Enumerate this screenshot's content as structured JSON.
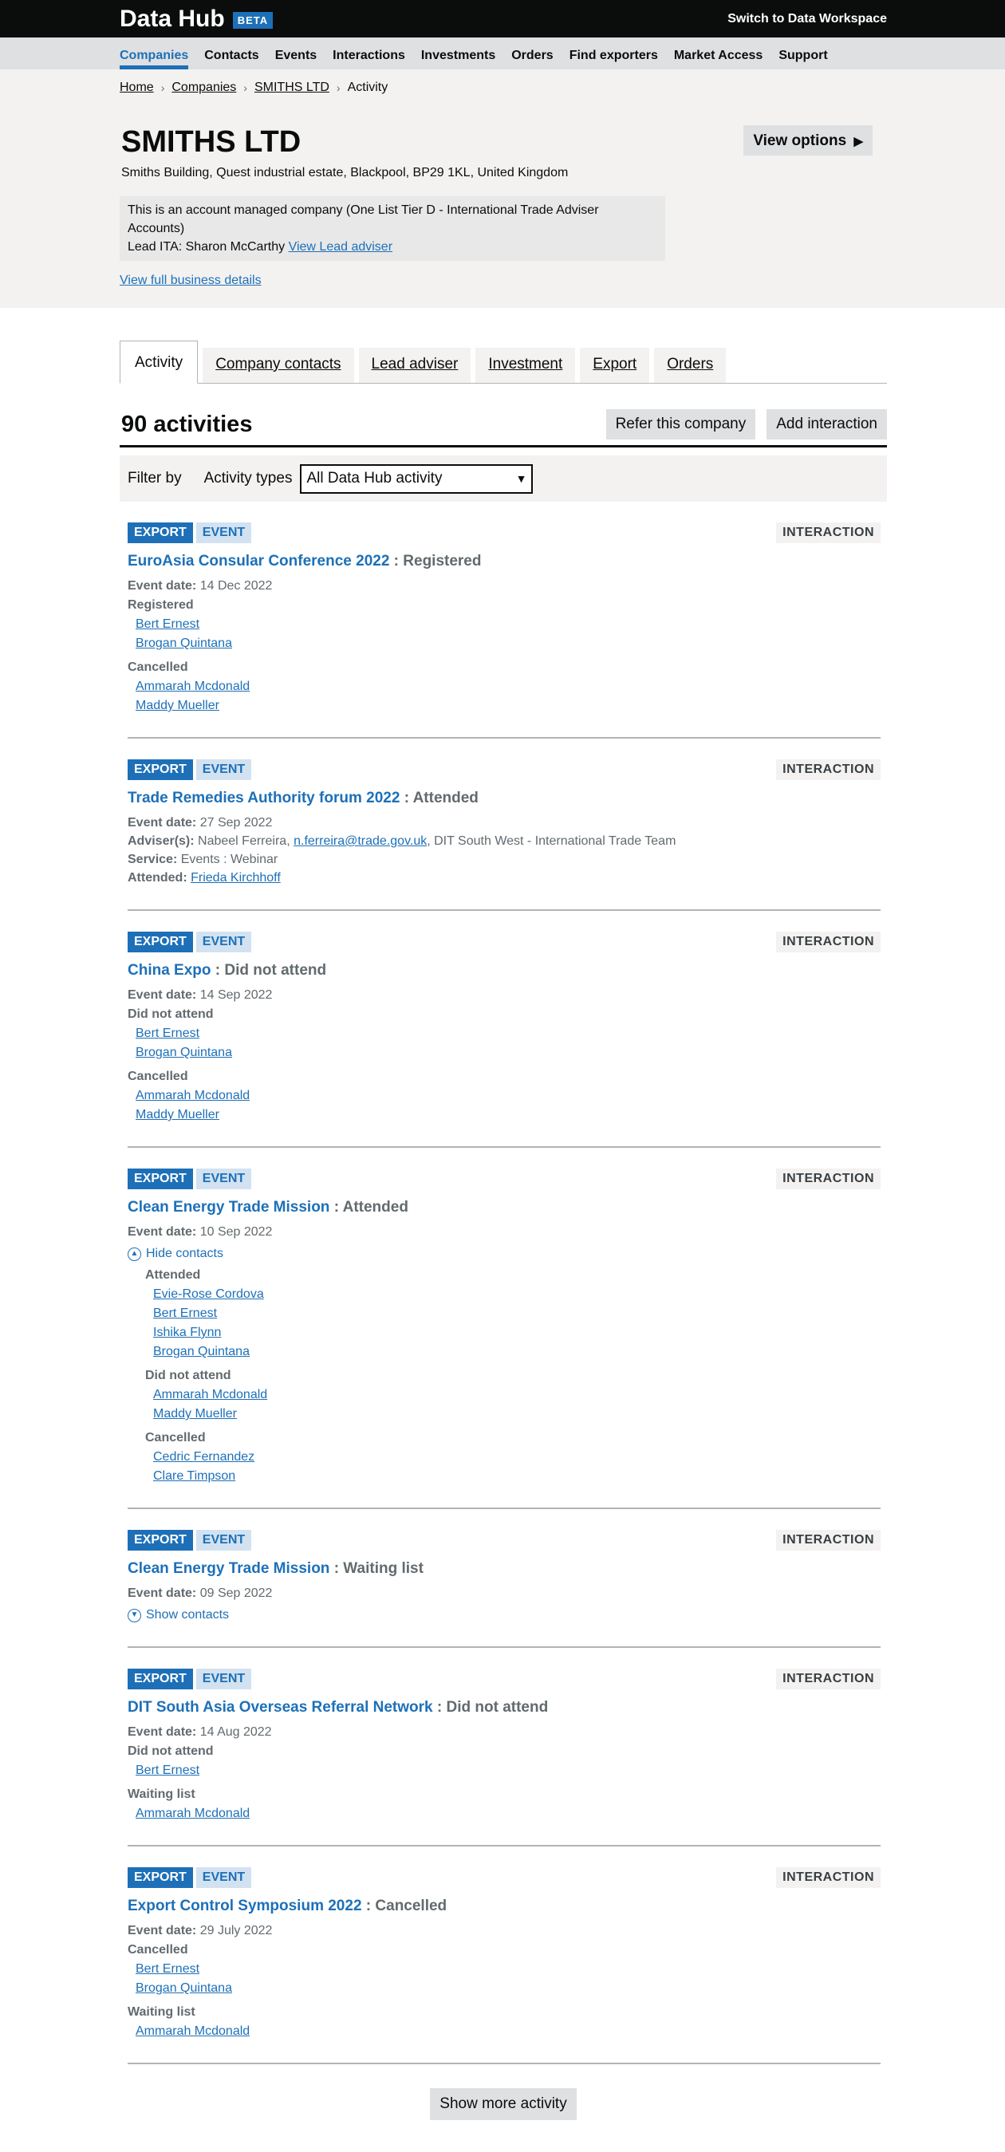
{
  "header": {
    "logo": "Data Hub",
    "beta": "BETA",
    "switch_link": "Switch to Data Workspace"
  },
  "nav": {
    "items": [
      "Companies",
      "Contacts",
      "Events",
      "Interactions",
      "Investments",
      "Orders",
      "Find exporters",
      "Market Access",
      "Support"
    ],
    "active": "Companies"
  },
  "breadcrumbs": {
    "home": "Home",
    "companies": "Companies",
    "company": "SMITHS LTD",
    "current": "Activity"
  },
  "company": {
    "name": "SMITHS LTD",
    "address": "Smiths Building, Quest industrial estate, Blackpool, BP29 1KL, United Kingdom",
    "view_options": "View options",
    "managed_text": "This is an account managed company (One List Tier D - International Trade Adviser Accounts)",
    "lead_ita_text": "Lead ITA: Sharon McCarthy",
    "view_lead_adviser": "View Lead adviser",
    "full_details": "View full business details"
  },
  "tabs": [
    "Activity",
    "Company contacts",
    "Lead adviser",
    "Investment",
    "Export",
    "Orders"
  ],
  "activity_header": {
    "count": "90 activities",
    "refer": "Refer this company",
    "add": "Add interaction"
  },
  "filter": {
    "filter_by": "Filter by",
    "activity_types": "Activity types",
    "selected": "All Data Hub activity"
  },
  "badges": {
    "export": "EXPORT",
    "event": "EVENT",
    "interaction": "INTERACTION"
  },
  "activities": [
    {
      "title": "EuroAsia Consular Conference 2022",
      "status": ": Registered",
      "event_date_label": "Event date:",
      "event_date": "14 Dec 2022",
      "groups": [
        {
          "label": "Registered",
          "contacts": [
            "Bert Ernest",
            "Brogan Quintana"
          ]
        },
        {
          "label": "Cancelled",
          "contacts": [
            "Ammarah Mcdonald",
            "Maddy Mueller"
          ]
        }
      ]
    },
    {
      "title": "Trade Remedies Authority forum 2022",
      "status": ": Attended",
      "event_date_label": "Event date:",
      "event_date": "27 Sep 2022",
      "advisers_label": "Adviser(s):",
      "advisers_name": "Nabeel Ferreira,",
      "advisers_email": "n.ferreira@trade.gov.uk",
      "advisers_team": ", DIT South West - International Trade Team",
      "service_label": "Service:",
      "service": "Events : Webinar",
      "attended_label": "Attended:",
      "attended": "Frieda Kirchhoff"
    },
    {
      "title": "China Expo",
      "status": ": Did not attend",
      "event_date_label": "Event date:",
      "event_date": "14 Sep 2022",
      "groups": [
        {
          "label": "Did not attend",
          "contacts": [
            "Bert Ernest",
            "Brogan Quintana"
          ]
        },
        {
          "label": "Cancelled",
          "contacts": [
            "Ammarah Mcdonald",
            "Maddy Mueller"
          ]
        }
      ]
    },
    {
      "title": "Clean Energy Trade Mission",
      "status": ": Attended",
      "event_date_label": "Event date:",
      "event_date": "10 Sep 2022",
      "toggle": "Hide contacts",
      "groups": [
        {
          "label": "Attended",
          "contacts": [
            "Evie-Rose Cordova",
            "Bert Ernest",
            "Ishika Flynn",
            "Brogan Quintana"
          ]
        },
        {
          "label": "Did not attend",
          "contacts": [
            "Ammarah Mcdonald",
            "Maddy Mueller"
          ]
        },
        {
          "label": "Cancelled",
          "contacts": [
            "Cedric Fernandez",
            "Clare Timpson"
          ]
        }
      ]
    },
    {
      "title": "Clean Energy Trade Mission",
      "status": ": Waiting list",
      "event_date_label": "Event date:",
      "event_date": "09 Sep 2022",
      "toggle": "Show contacts"
    },
    {
      "title": "DIT South Asia Overseas Referral Network",
      "status": ": Did not attend",
      "event_date_label": "Event date:",
      "event_date": "14 Aug 2022",
      "groups": [
        {
          "label": "Did not attend",
          "contacts": [
            "Bert Ernest"
          ]
        },
        {
          "label": "Waiting list",
          "contacts": [
            "Ammarah Mcdonald"
          ]
        }
      ]
    },
    {
      "title": "Export Control Symposium 2022",
      "status": ": Cancelled",
      "event_date_label": "Event date:",
      "event_date": "29 July 2022",
      "groups": [
        {
          "label": "Cancelled",
          "contacts": [
            "Bert Ernest",
            "Brogan Quintana"
          ]
        },
        {
          "label": "Waiting list",
          "contacts": [
            "Ammarah Mcdonald"
          ]
        }
      ]
    }
  ],
  "show_more": "Show more activity",
  "colors": {
    "brand_blue": "#1d70b8",
    "header_black": "#0b0c0c",
    "nav_grey": "#dee0e2",
    "panel_grey": "#f3f2f1",
    "secondary_text": "#626a6e"
  },
  "icons": {
    "breadcrumb_separator": "chevron-right-icon",
    "view_options": "triangle-right-icon",
    "select": "chevron-down-icon",
    "hide_contacts": "chevron-up-circle-icon",
    "show_contacts": "chevron-down-circle-icon"
  }
}
